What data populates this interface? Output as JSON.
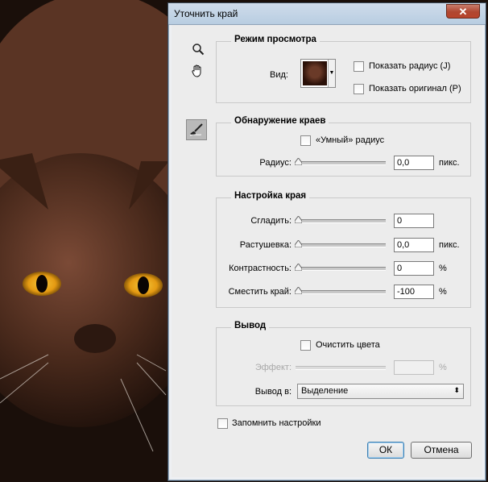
{
  "window": {
    "title": "Уточнить край",
    "close_glyph": "✕"
  },
  "tools": [
    "zoom-icon",
    "hand-icon",
    "refine-radius-brush-icon"
  ],
  "view_mode": {
    "title": "Режим просмотра",
    "view_label": "Вид:",
    "show_radius": {
      "label": "Показать радиус (J)",
      "checked": false
    },
    "show_original": {
      "label": "Показать оригинал (P)",
      "checked": false
    }
  },
  "edge_detection": {
    "title": "Обнаружение краев",
    "smart_radius": {
      "label": "«Умный» радиус",
      "checked": false
    },
    "radius": {
      "label": "Радиус:",
      "value": "0,0",
      "unit": "пикс.",
      "level": 0
    }
  },
  "adjust_edge": {
    "title": "Настройка края",
    "smooth": {
      "label": "Сгладить:",
      "value": "0",
      "unit": "",
      "level": 0
    },
    "feather": {
      "label": "Растушевка:",
      "value": "0,0",
      "unit": "пикс.",
      "level": 0
    },
    "contrast": {
      "label": "Контрастность:",
      "value": "0",
      "unit": "%",
      "level": 0
    },
    "shift_edge": {
      "label": "Сместить край:",
      "value": "-100",
      "unit": "%",
      "level": 0
    }
  },
  "output": {
    "title": "Вывод",
    "decontaminate": {
      "label": "Очистить цвета",
      "checked": false
    },
    "amount": {
      "label": "Эффект:",
      "value": "",
      "unit": "%",
      "disabled": true
    },
    "output_to": {
      "label": "Вывод в:",
      "selected": "Выделение"
    }
  },
  "remember": {
    "label": "Запомнить настройки",
    "checked": false
  },
  "buttons": {
    "ok": "ОК",
    "cancel": "Отмена"
  },
  "colors": {
    "titlebar": "#c3d4e6",
    "close": "#b04630",
    "panel": "#ececec",
    "eye": "#e8a81c"
  }
}
